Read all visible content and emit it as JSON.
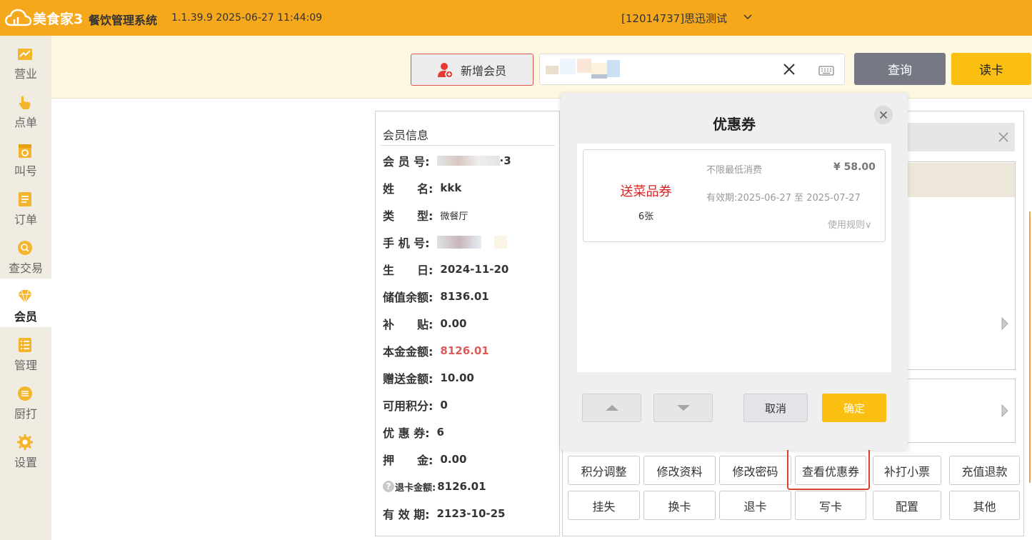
{
  "header": {
    "logo_text": "美食家3",
    "system_name": "餐饮管理系统",
    "version": "1.1.39.9 2025-06-27 11:44:09",
    "store": "[12014737]思迅测试"
  },
  "sidebar": {
    "items": [
      {
        "label": "营业",
        "icon": "chart-icon"
      },
      {
        "label": "点单",
        "icon": "hand-icon"
      },
      {
        "label": "叫号",
        "icon": "ticket-icon"
      },
      {
        "label": "订单",
        "icon": "list-icon"
      },
      {
        "label": "查交易",
        "icon": "search-icon"
      },
      {
        "label": "会员",
        "icon": "diamond-icon"
      },
      {
        "label": "管理",
        "icon": "checklist-icon"
      },
      {
        "label": "厨打",
        "icon": "menu-icon"
      },
      {
        "label": "设置",
        "icon": "gear-icon"
      }
    ],
    "active_index": 5
  },
  "toolbar": {
    "add_member_label": "新增会员",
    "query_label": "查询",
    "read_card_label": "读卡"
  },
  "member_info": {
    "title": "会员信息",
    "rows": [
      {
        "label": "会 员 号:",
        "value": "·3"
      },
      {
        "label": "姓　　名:",
        "value": "kkk"
      },
      {
        "label": "类　　型:",
        "value": "微餐厅"
      },
      {
        "label": "手 机 号:",
        "value": ""
      },
      {
        "label": "生　　日:",
        "value": "2024-11-20"
      },
      {
        "label": "储值余额:",
        "value": "8136.01"
      },
      {
        "label": "补　　贴:",
        "value": "0.00"
      },
      {
        "label": "本金金额:",
        "value": "8126.01"
      },
      {
        "label": "赠送金额:",
        "value": "10.00"
      },
      {
        "label": "可用积分:",
        "value": "0"
      },
      {
        "label": "优 惠 券:",
        "value": "6"
      },
      {
        "label": "押　　金:",
        "value": "0.00"
      },
      {
        "label": "退卡金额:",
        "value": "8126.01"
      },
      {
        "label": "有 效 期:",
        "value": "2123-10-25"
      }
    ]
  },
  "actions": {
    "row1": [
      "积分调整",
      "修改资料",
      "修改密码",
      "查看优惠券",
      "补打小票",
      "充值退款"
    ],
    "row2": [
      "挂失",
      "换卡",
      "退卡",
      "写卡",
      "配置",
      "其他"
    ]
  },
  "coupon_modal": {
    "title": "优惠券",
    "coupon": {
      "name": "送菜品券",
      "count": "6张",
      "min_spend": "不限最低消费",
      "price": "¥ 58.00",
      "validity": "有效期:2025-06-27 至 2025-07-27",
      "rules": "使用规则∨"
    },
    "cancel_label": "取消",
    "confirm_label": "确定"
  },
  "colors": {
    "header": "#f5a81c",
    "accent_yellow": "#fbbf11",
    "query_gray": "#767983",
    "danger": "#d6432f"
  }
}
